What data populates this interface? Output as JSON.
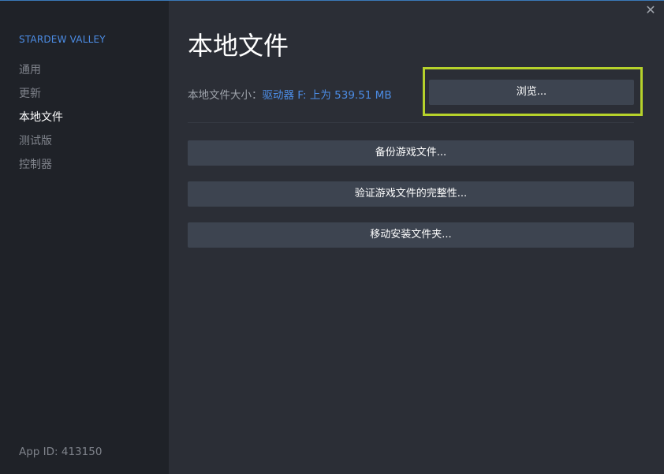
{
  "window": {
    "close_glyph": "✕"
  },
  "sidebar": {
    "game_title": "STARDEW VALLEY",
    "items": [
      {
        "label": "通用"
      },
      {
        "label": "更新"
      },
      {
        "label": "本地文件",
        "active": true
      },
      {
        "label": "测试版"
      },
      {
        "label": "控制器"
      }
    ],
    "app_id": "App ID: 413150"
  },
  "main": {
    "title": "本地文件",
    "size_label": "本地文件大小：",
    "size_value": "驱动器 F: 上为 539.51 MB",
    "browse_label": "浏览...",
    "buttons": {
      "backup": "备份游戏文件...",
      "verify": "验证游戏文件的完整性...",
      "move": "移动安装文件夹..."
    }
  },
  "colors": {
    "accent_link": "#4c8de6",
    "highlight_border": "#b6d22b",
    "button_bg": "#3d4450",
    "sidebar_bg": "#1f2228",
    "main_bg": "#2b2e36"
  },
  "icons": {
    "close": "close-icon"
  }
}
